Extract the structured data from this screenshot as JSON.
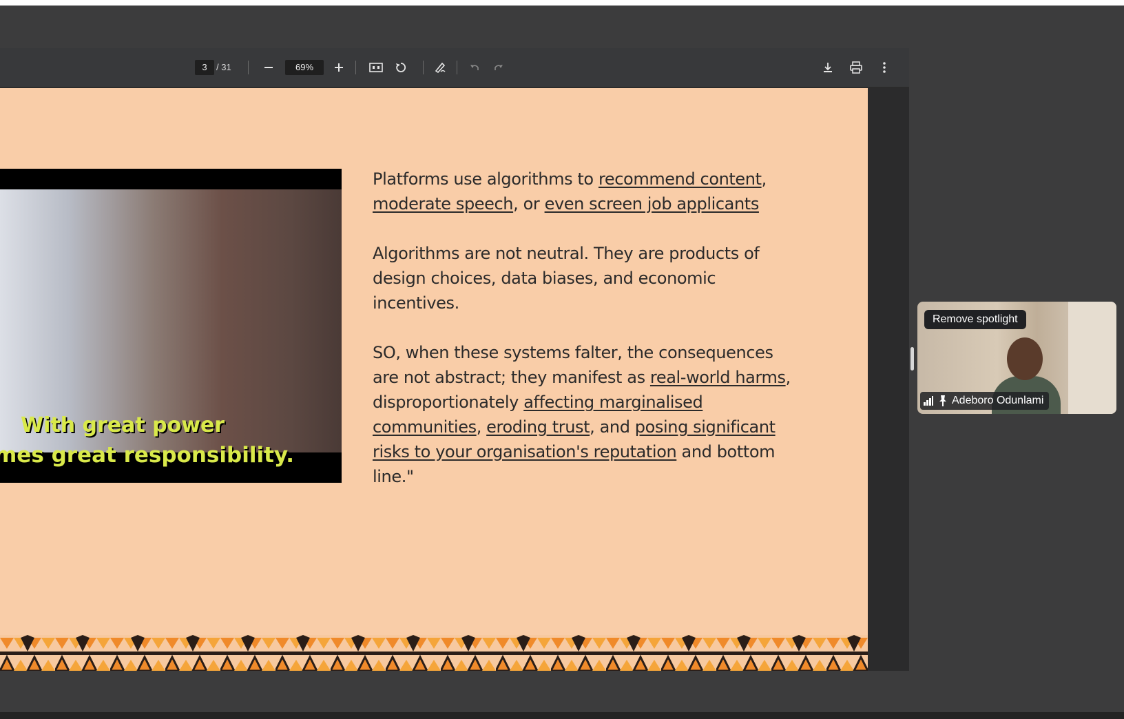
{
  "pdf_toolbar": {
    "current_page": "3",
    "total_pages": "/ 31",
    "zoom": "69%",
    "icons": [
      "minus-icon",
      "plus-icon",
      "fit-page-icon",
      "rotate-icon",
      "annotate-icon",
      "undo-icon",
      "redo-icon",
      "download-icon",
      "print-icon",
      "more-vert-icon"
    ]
  },
  "slide": {
    "caption_line1": "With great power",
    "caption_line2": "mes great responsibility.",
    "para1": {
      "pre": "Platforms use algorithms to ",
      "link1": "recommend content",
      "mid1": ", ",
      "link2": "moderate speech",
      "mid2": ", or ",
      "link3": "even screen job applicants"
    },
    "para2": " Algorithms are not neutral. They are products of design choices, data biases, and economic incentives.",
    "para3": {
      "pre": "SO, when these systems falter, the consequences are not abstract; they manifest as ",
      "link1": "real-world harms",
      "mid1": ", disproportionately ",
      "link2": "affecting marginalised communities",
      "mid2": ", ",
      "link3": "eroding trust",
      "mid3": ", and ",
      "link4": "posing significant risks to your organisation's reputation",
      "post": " and bottom line.\""
    },
    "colors": {
      "background": "#f9cda8",
      "pattern_orange": "#f08a2a",
      "pattern_dark": "#2a1d17"
    }
  },
  "participant_tile": {
    "spotlight_button": "Remove spotlight",
    "participant_name": "Adeboro Odunlami",
    "icons": [
      "signal-bars-icon",
      "pin-icon"
    ]
  }
}
